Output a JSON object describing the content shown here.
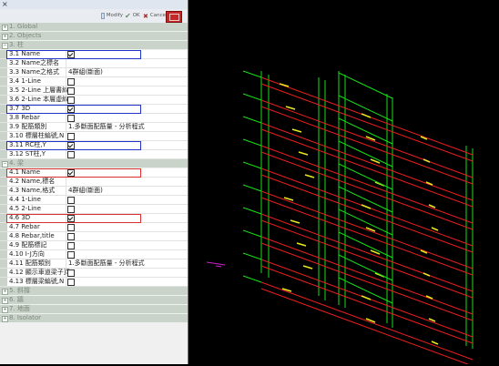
{
  "window": {
    "close_glyph": "×"
  },
  "toolbar": {
    "modify_label": "Modify",
    "ok_label": "OK",
    "cancel_label": "Cancel"
  },
  "categories": {
    "global": "1. Global",
    "objects": "2. Objects",
    "column": "3. 柱",
    "beam": "4. 梁",
    "brace": "5. 斜撐",
    "wall": "6. 牆",
    "foundation": "7. 地面",
    "isolator": "8. Isolator"
  },
  "props": {
    "p3_1": {
      "label": "3.1 Name",
      "checked": true
    },
    "p3_2": {
      "label": "3.2 Name之標名"
    },
    "p3_3": {
      "label": "3.3 Name之格式",
      "value": "4群組(斷面)"
    },
    "p3_4": {
      "label": "3.4 1-Line",
      "checked": false
    },
    "p3_5": {
      "label": "3.5 2-Line 上層書線",
      "checked": false
    },
    "p3_6": {
      "label": "3.6 2-Line 本層虛線",
      "checked": false
    },
    "p3_7": {
      "label": "3.7 3D",
      "checked": true
    },
    "p3_8": {
      "label": "3.8 Rebar",
      "checked": false
    },
    "p3_9": {
      "label": "3.9 配筋類別",
      "value": "1.多斷面配筋量 - 分析程式"
    },
    "p3_10": {
      "label": "3.10 標層柱編號,N",
      "checked": false
    },
    "p3_11": {
      "label": "3.11 RC柱,Y",
      "checked": true
    },
    "p3_12": {
      "label": "3.12 ST柱,Y",
      "checked": false
    },
    "p4_1": {
      "label": "4.1 Name",
      "checked": true
    },
    "p4_2": {
      "label": "4.2 Name,標名"
    },
    "p4_3": {
      "label": "4.3 Name,格式",
      "value": "4群組(斷面)"
    },
    "p4_4": {
      "label": "4.4 1-Line",
      "checked": false
    },
    "p4_5": {
      "label": "4.5 2-Line",
      "checked": false
    },
    "p4_6": {
      "label": "4.6 3D",
      "checked": true
    },
    "p4_7": {
      "label": "4.7 Rebar",
      "checked": false
    },
    "p4_8": {
      "label": "4.8 Rebar,title",
      "checked": false
    },
    "p4_9": {
      "label": "4.9 配筋標記",
      "checked": false
    },
    "p4_10": {
      "label": "4.10 I-J方向",
      "checked": false
    },
    "p4_11": {
      "label": "4.11 配筋類別",
      "value": "1.多斷面配筋量 - 分析程式"
    },
    "p4_12": {
      "label": "4.12 顯示車道梁子頁",
      "checked": false
    },
    "p4_13": {
      "label": "4.13 標層梁編號,N",
      "checked": false
    }
  },
  "viewport": {
    "colors": {
      "frame": "#16e016",
      "beam": "#e61e1e",
      "marker": "#e8e820",
      "stray": "#d020d0",
      "background": "#000000"
    },
    "floors": 10
  }
}
